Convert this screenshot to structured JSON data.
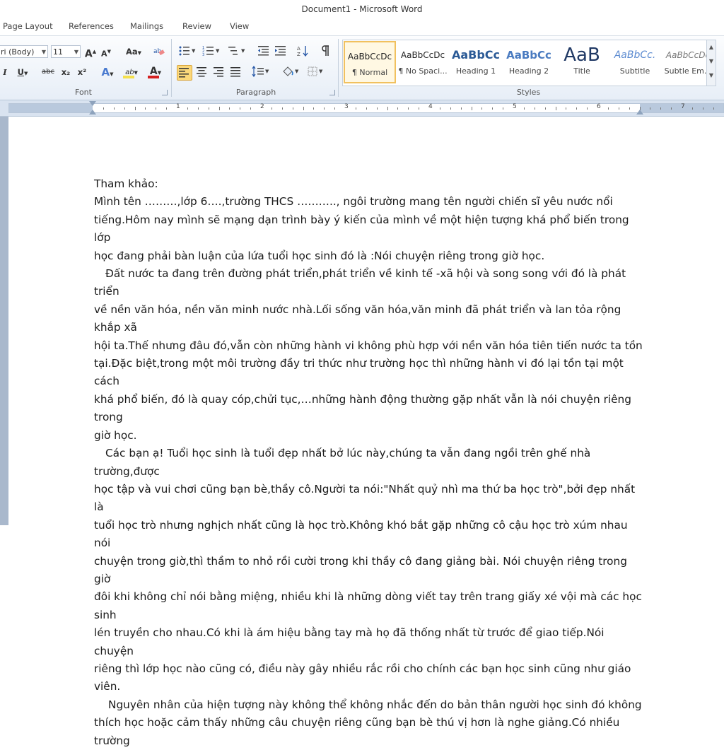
{
  "window": {
    "title": "Document1 - Microsoft Word"
  },
  "tabs": [
    "Page Layout",
    "References",
    "Mailings",
    "Review",
    "View"
  ],
  "ribbon": {
    "font": {
      "group_label": "Font",
      "font_name": "ri (Body)",
      "font_size": "11",
      "grow_label": "A",
      "shrink_label": "A",
      "case_label": "Aa",
      "italic": "I",
      "underline": "U",
      "strike": "abc",
      "subscript": "x₂",
      "superscript": "x²",
      "effects": "A",
      "highlight": "ab",
      "font_color": "A",
      "highlight_color": "#f4e04d",
      "font_color_value": "#d42020"
    },
    "paragraph": {
      "group_label": "Paragraph"
    },
    "styles": {
      "group_label": "Styles",
      "items": [
        {
          "preview": "AaBbCcDc",
          "name": "¶ Normal"
        },
        {
          "preview": "AaBbCcDc",
          "name": "¶ No Spaci..."
        },
        {
          "preview": "AaBbCc",
          "name": "Heading 1"
        },
        {
          "preview": "AaBbCc",
          "name": "Heading 2"
        },
        {
          "preview": "AaB",
          "name": "Title"
        },
        {
          "preview": "AaBbCc.",
          "name": "Subtitle"
        },
        {
          "preview": "AaBbCcDc",
          "name": "Subtle Em..."
        }
      ]
    }
  },
  "ruler": {
    "numbers": [
      "1",
      "2",
      "3",
      "4",
      "5",
      "6",
      "7"
    ]
  },
  "document": {
    "heading": "Tham khảo:",
    "lines": [
      "Mình tên ………,lớp 6….,trường THCS ……….., ngôi trường mang tên người chiến sĩ  yêu nước nổi",
      "tiếng.Hôm nay mình sẽ mạng dạn trình bày ý kiến của mình về một hiện tượng khá phổ biến trong lớp",
      "học đang phải bàn luận của lứa tuổi học sinh đó là :Nói chuyện riêng trong giờ học.",
      "Đất nước ta đang trên đường phát triển,phát triển về kinh tế -xã hội và song song với đó là phát triển",
      "về nền văn hóa, nền văn minh nước nhà.Lối sống văn hóa,văn minh đã phát triển và lan tỏa rộng khắp xã",
      "hội ta.Thế nhưng đâu đó,vẫn còn những hành vi không phù hợp với nền văn hóa tiên tiến nước ta tồn",
      "tại.Đặc biệt,trong một môi trường đầy tri thức như trường học thì những hành vi đó lại tồn tại một cách",
      "khá phổ biến, đó là quay cóp,chửi tục,…những hành động thường gặp nhất vẫn là nói chuyện riêng trong",
      "giờ học.",
      "Các bạn ạ! Tuổi học sinh là tuổi đẹp nhất bở lúc này,chúng ta vẫn đang ngồi trên ghế nhà trường,được",
      "học tập và vui chơi cũng bạn bè,thầy cô.Người ta nói:\"Nhất quỷ nhì ma thứ ba học trò\",bởi đẹp nhất là",
      "tuổi học trò nhưng nghịch nhất cũng là học trò.Không khó bắt gặp những cô cậu học trò xúm nhau nói",
      "chuyện trong giờ,thì thầm to nhỏ rồi cười trong khi thầy cô đang giảng bài. Nói chuyện riêng trong giờ",
      "đôi khi không chỉ nói bằng miệng, nhiều khi là những dòng viết tay trên trang giấy xé vội mà các học sinh",
      "lén truyền cho nhau.Có khi là ám hiệu bằng tay mà họ đã thống nhất từ trước để giao tiếp.Nói chuyện",
      "riêng thì lớp học  nào cũng có, điều này gây nhiều rắc rồi cho chính các bạn học sinh cũng như giáo viên.",
      "Nguyên nhân của hiện tượng này không thể không nhắc đến do bản thân người học sinh đó không",
      "thích học hoặc cảm thấy những câu chuyện riêng cũng bạn bè thú vị hơn là nghe giảng.Có nhiều trường"
    ]
  }
}
